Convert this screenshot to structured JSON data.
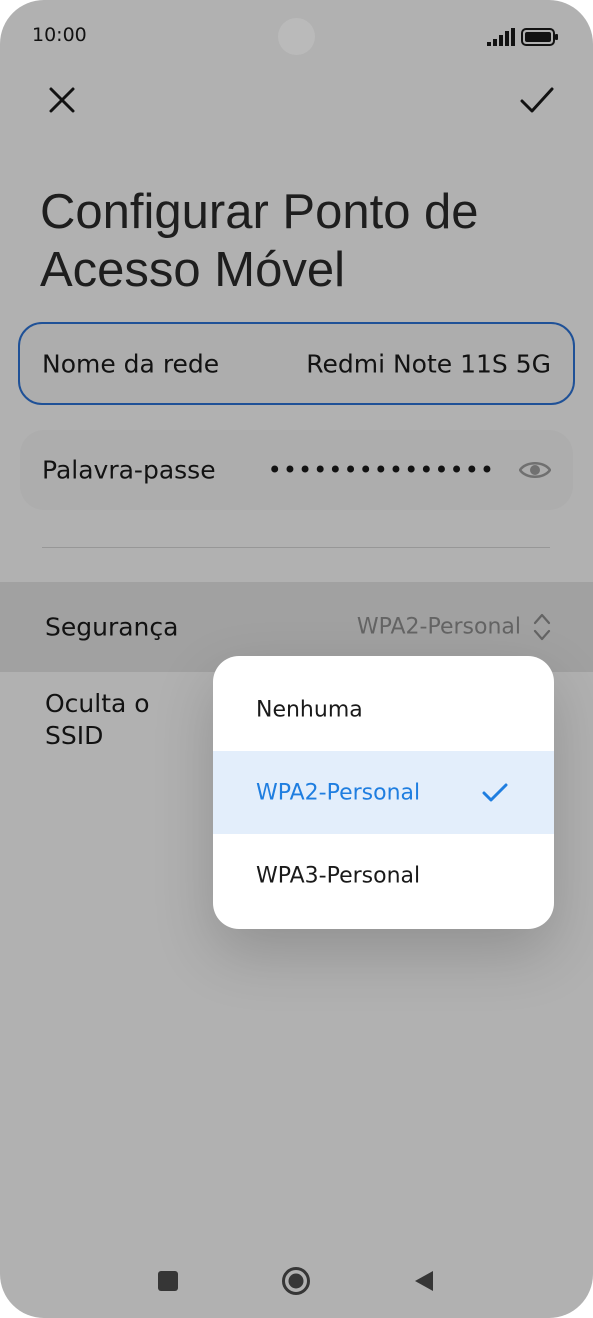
{
  "status_bar": {
    "time": "10:00"
  },
  "toolbar": {
    "close_icon": "close-icon",
    "confirm_icon": "check-icon"
  },
  "page": {
    "title": "Configurar Ponto de Acesso Móvel"
  },
  "fields": {
    "network_name": {
      "label": "Nome da rede",
      "value": "Redmi Note 11S 5G"
    },
    "password": {
      "label": "Palavra-passe",
      "value": "•••••••••••••••"
    }
  },
  "security": {
    "label": "Segurança",
    "value": "WPA2-Personal"
  },
  "hide_ssid": {
    "label": "Oculta o SSID"
  },
  "dropdown": {
    "options": [
      {
        "label": "Nenhuma",
        "selected": false
      },
      {
        "label": "WPA2-Personal",
        "selected": true
      },
      {
        "label": "WPA3-Personal",
        "selected": false
      }
    ]
  },
  "colors": {
    "accent": "#1f7ee0",
    "focus_border": "#2b6fcf",
    "selected_bg": "#e3eefb"
  }
}
